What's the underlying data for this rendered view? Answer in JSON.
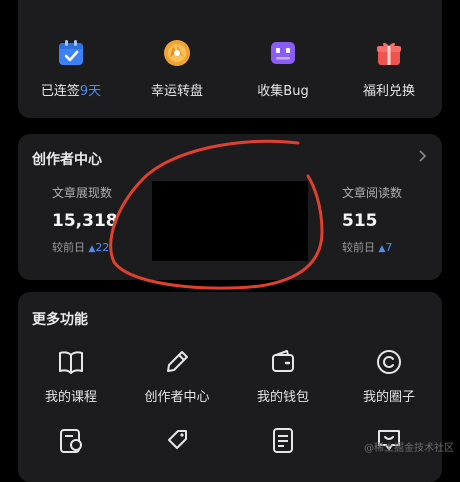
{
  "quick_actions": [
    {
      "icon": "calendar-check-icon",
      "label_prefix": "已连签",
      "label_highlight": "9天"
    },
    {
      "icon": "lucky-wheel-icon",
      "label": "幸运转盘"
    },
    {
      "icon": "bug-collect-icon",
      "label": "收集Bug"
    },
    {
      "icon": "gift-icon",
      "label": "福利兑换"
    }
  ],
  "creator": {
    "title": "创作者中心",
    "stats": [
      {
        "label": "文章展现数",
        "value": "15,318",
        "delta_label": "较前日",
        "delta_value": "22"
      },
      {
        "label": "文章阅读数",
        "value": "515",
        "delta_label": "较前日",
        "delta_value": "7"
      }
    ]
  },
  "more": {
    "title": "更多功能",
    "items": [
      {
        "icon": "book-icon",
        "label": "我的课程"
      },
      {
        "icon": "pen-icon",
        "label": "创作者中心"
      },
      {
        "icon": "wallet-icon",
        "label": "我的钱包"
      },
      {
        "icon": "circle-smile-icon",
        "label": "我的圈子"
      }
    ],
    "row2_icons": [
      "clipboard-clock-icon",
      "tag-icon",
      "document-list-icon",
      "message-icon"
    ]
  },
  "watermark": "@稀土掘金技术社区",
  "colors": {
    "accent": "#4e8df7",
    "card": "#1c1c1e",
    "background": "#000000",
    "scribble": "#e0412f"
  }
}
